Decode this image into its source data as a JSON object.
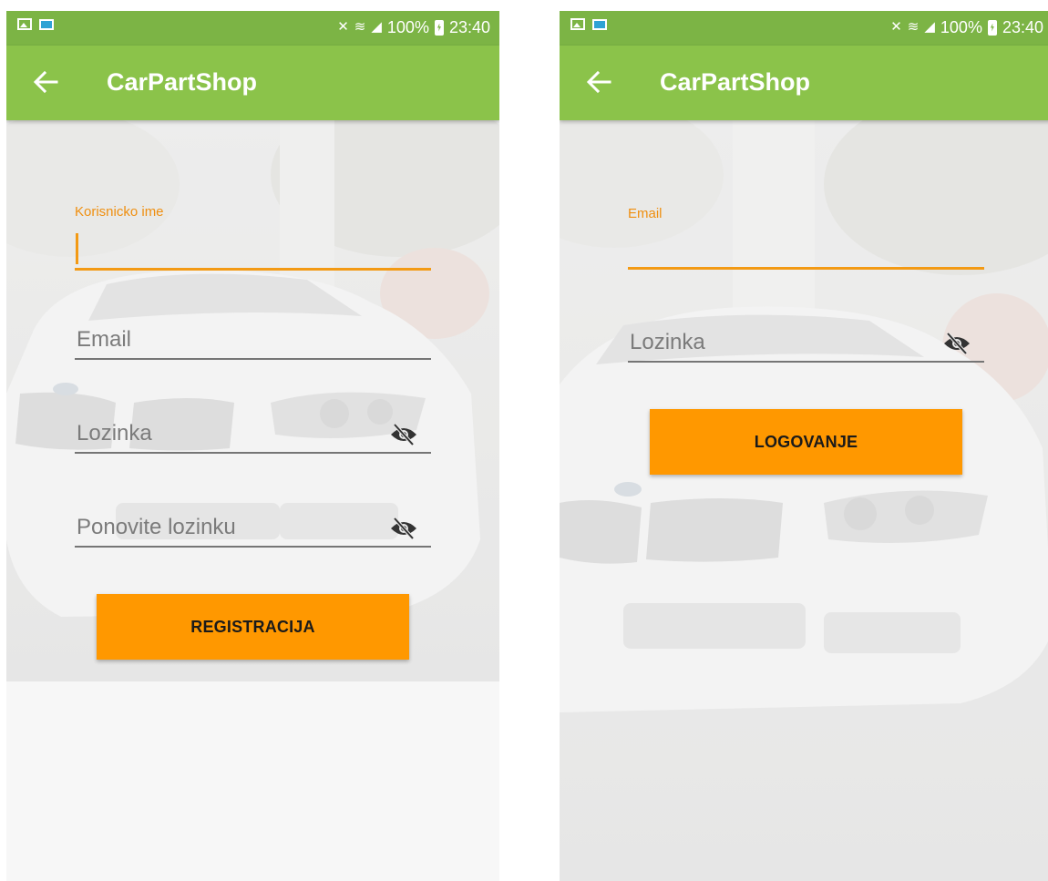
{
  "status_bar": {
    "battery": "100%",
    "time": "23:40"
  },
  "app": {
    "title": "CarPartShop"
  },
  "register": {
    "username_label": "Korisnicko ime",
    "username_value": "",
    "email_placeholder": "Email",
    "password_placeholder": "Lozinka",
    "repeat_password_placeholder": "Ponovite lozinku",
    "submit_label": "REGISTRACIJA"
  },
  "login": {
    "email_label": "Email",
    "email_value": "",
    "password_placeholder": "Lozinka",
    "submit_label": "LOGOVANJE"
  },
  "colors": {
    "app_bar": "#8bc34a",
    "status_bar": "#7cb445",
    "accent": "#f39a14",
    "button": "#ff9800"
  },
  "icons": {
    "back": "arrow-left-icon",
    "password_toggle": "eye-off-icon"
  }
}
